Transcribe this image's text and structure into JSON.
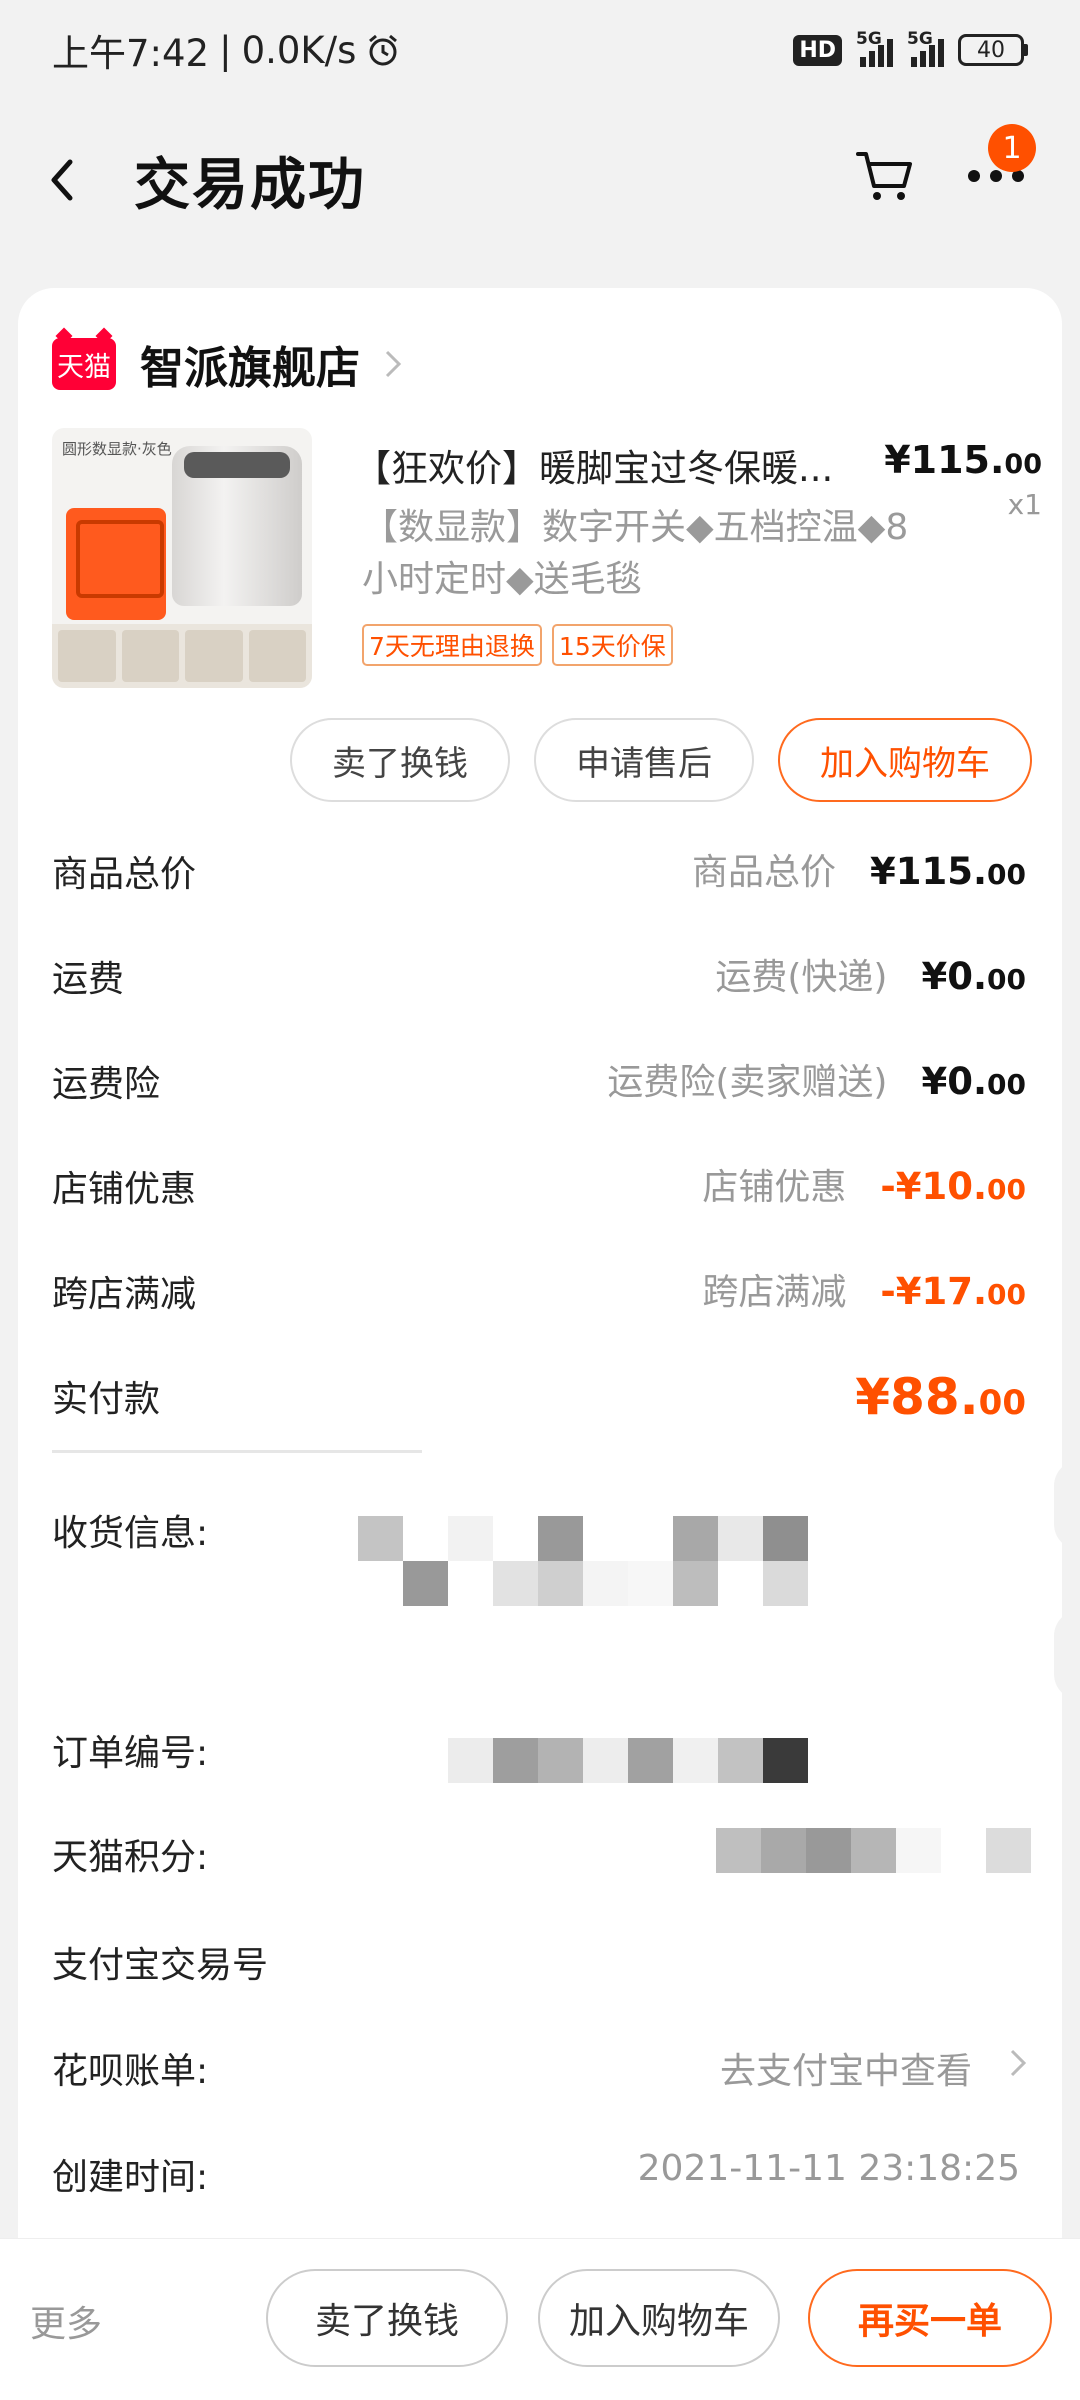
{
  "status_bar": {
    "time": "上午7:42",
    "net_speed": "0.0K/s",
    "hd_label": "HD",
    "net1": "5G",
    "net2": "5G",
    "battery": "40"
  },
  "header": {
    "title": "交易成功",
    "badge_count": "1"
  },
  "shop": {
    "logo_text": "天猫",
    "name": "智派旗舰店"
  },
  "product": {
    "title": "【狂欢价】暖脚宝过冬保暖...",
    "price_int": "¥115.",
    "price_cents": "00",
    "quantity": "x1",
    "spec": "【数显款】数字开关◆五档控温◆8小时定时◆送毛毯",
    "tags": [
      "7天无理由退换",
      "15天价保"
    ],
    "image_caption": "圆形数显款·灰色"
  },
  "actions": {
    "sell_label": "卖了换钱",
    "after_sale_label": "申请售后",
    "add_cart_label": "加入购物车"
  },
  "fees": [
    {
      "label": "商品总价",
      "sub": "商品总价",
      "amount_int": "¥115.",
      "amount_cents": "00"
    },
    {
      "label": "运费",
      "sub": "运费(快递)",
      "amount_int": "¥0.",
      "amount_cents": "00"
    },
    {
      "label": "运费险",
      "sub": "运费险(卖家赠送)",
      "amount_int": "¥0.",
      "amount_cents": "00"
    },
    {
      "label": "店铺优惠",
      "sub": "店铺优惠",
      "amount_int": "-¥10.",
      "amount_cents": "00"
    },
    {
      "label": "跨店满减",
      "sub": "跨店满减",
      "amount_int": "-¥17.",
      "amount_cents": "00"
    },
    {
      "label": "实付款",
      "sub": "",
      "amount_int": "¥88.",
      "amount_cents": "00"
    }
  ],
  "info": {
    "shipping_label": "收货信息:",
    "order_no_label": "订单编号:",
    "points_label": "天猫积分:",
    "alipay_label": "支付宝交易号",
    "huabei_label": "花呗账单:",
    "huabei_value": "去支付宝中查看",
    "created_label": "创建时间:",
    "created_value": "2021-11-11 23:18:25"
  },
  "bottom_bar": {
    "more": "更多",
    "sell_label": "卖了换钱",
    "add_cart_label": "加入购物车",
    "rebuy_label": "再买一单"
  },
  "colors": {
    "accent": "#ff5000",
    "tmall_red": "#ff0036"
  }
}
